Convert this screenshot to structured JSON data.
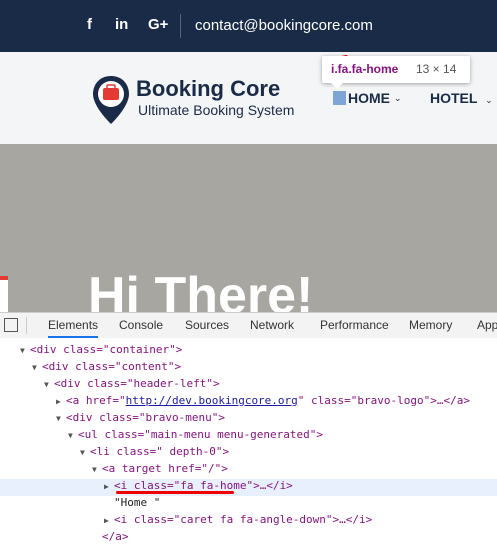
{
  "topbar": {
    "social": [
      "f",
      "in",
      "G+"
    ],
    "email": "contact@bookingcore.com"
  },
  "header": {
    "brand": "Booking Core",
    "tagline": "Ultimate Booking System",
    "nav": {
      "home": "HOME",
      "hotel": "HOTEL"
    }
  },
  "tooltip": {
    "selector": "i.fa.fa-home",
    "dimensions": "13 × 14"
  },
  "hero": {
    "title": "Hi There!"
  },
  "devtools": {
    "tabs": [
      "Elements",
      "Console",
      "Sources",
      "Network",
      "Performance",
      "Memory",
      "App"
    ],
    "lines": [
      {
        "t1": "<div class=\"container\">"
      },
      {
        "t1": "<div class=\"content\">"
      },
      {
        "t1": "<div class=\"header-left\">"
      },
      {
        "a": "<a href=\"",
        "link": "http://dev.bookingcore.org",
        "b": "\" class=\"bravo-logo\">…</a>"
      },
      {
        "t1": "<div class=\"bravo-menu\">"
      },
      {
        "t1": "<ul class=\"main-menu menu-generated\">"
      },
      {
        "t1": "<li class=\" depth-0\">"
      },
      {
        "t1": "<a target href=\"/\">"
      },
      {
        "t1": "<i class=\"fa fa-home\">…</i>"
      },
      {
        "t1": "\"Home \""
      },
      {
        "t1": "<i class=\"caret fa fa-angle-down\">…</i>"
      },
      {
        "t1": "</a>"
      }
    ]
  },
  "colors": {
    "navy": "#1a2b48",
    "accent": "#e53935",
    "highlight": "#e8f0fe"
  }
}
